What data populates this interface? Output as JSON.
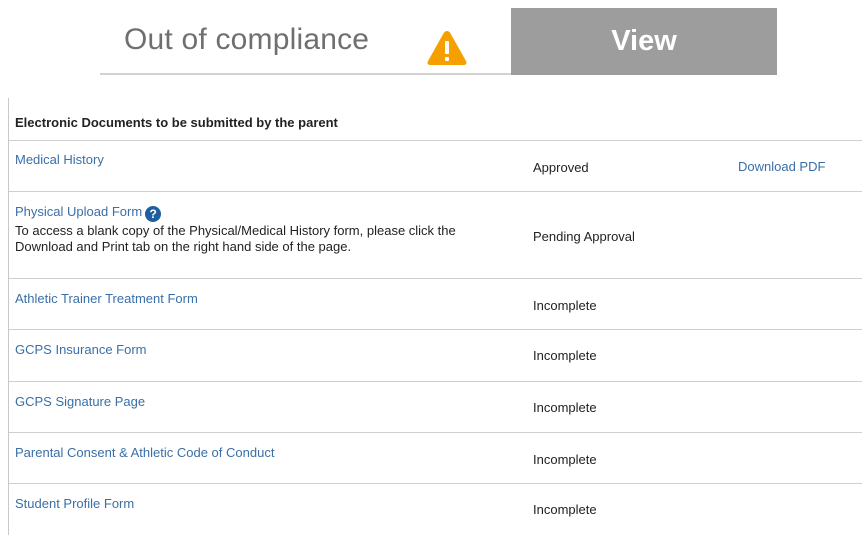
{
  "status": {
    "text": "Out of compliance",
    "icon": "warning-icon",
    "view_label": "View",
    "colors": {
      "warning": "#f5a000",
      "button": "#9d9d9d",
      "link": "#3a6fa8"
    }
  },
  "documents": {
    "header": "Electronic Documents to be submitted by the parent",
    "rows": [
      {
        "title": "Medical History",
        "status": "Approved",
        "action": "Download PDF"
      },
      {
        "title": "Physical Upload Form",
        "description": "To access a blank copy of the Physical/Medical History form, please click the Download and Print tab on the right hand side of the page.",
        "status": "Pending Approval",
        "help_icon": "?"
      },
      {
        "title": "Athletic Trainer Treatment Form",
        "status": "Incomplete"
      },
      {
        "title": "GCPS Insurance Form",
        "status": "Incomplete"
      },
      {
        "title": "GCPS Signature Page",
        "status": "Incomplete"
      },
      {
        "title": "Parental Consent & Athletic Code of Conduct",
        "status": "Incomplete"
      },
      {
        "title": "Student Profile Form",
        "status": "Incomplete"
      }
    ]
  }
}
